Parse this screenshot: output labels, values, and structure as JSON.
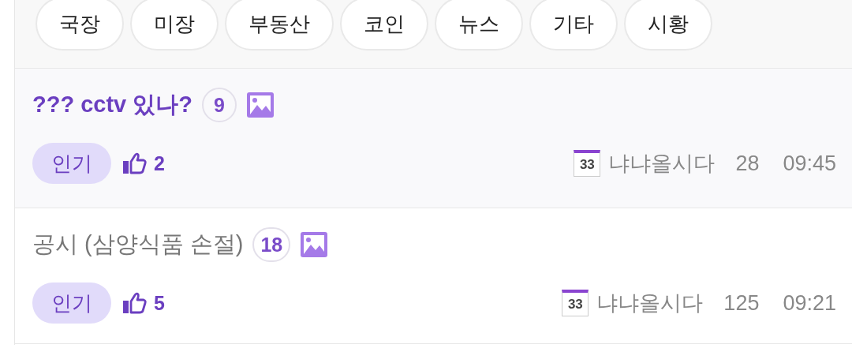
{
  "categories": [
    {
      "label": "국장"
    },
    {
      "label": "미장"
    },
    {
      "label": "부동산"
    },
    {
      "label": "코인"
    },
    {
      "label": "뉴스"
    },
    {
      "label": "기타"
    },
    {
      "label": "시황"
    }
  ],
  "posts": [
    {
      "title": "??? cctv 있나?",
      "read": false,
      "comments": "9",
      "has_image": true,
      "tag": "인기",
      "likes": "2",
      "level_badge": "33",
      "author": "냐냐올시다",
      "views": "28",
      "time": "09:45"
    },
    {
      "title": "공시 (삼양식품 손절)",
      "read": true,
      "comments": "18",
      "has_image": true,
      "tag": "인기",
      "likes": "5",
      "level_badge": "33",
      "author": "냐냐올시다",
      "views": "125",
      "time": "09:21"
    }
  ]
}
